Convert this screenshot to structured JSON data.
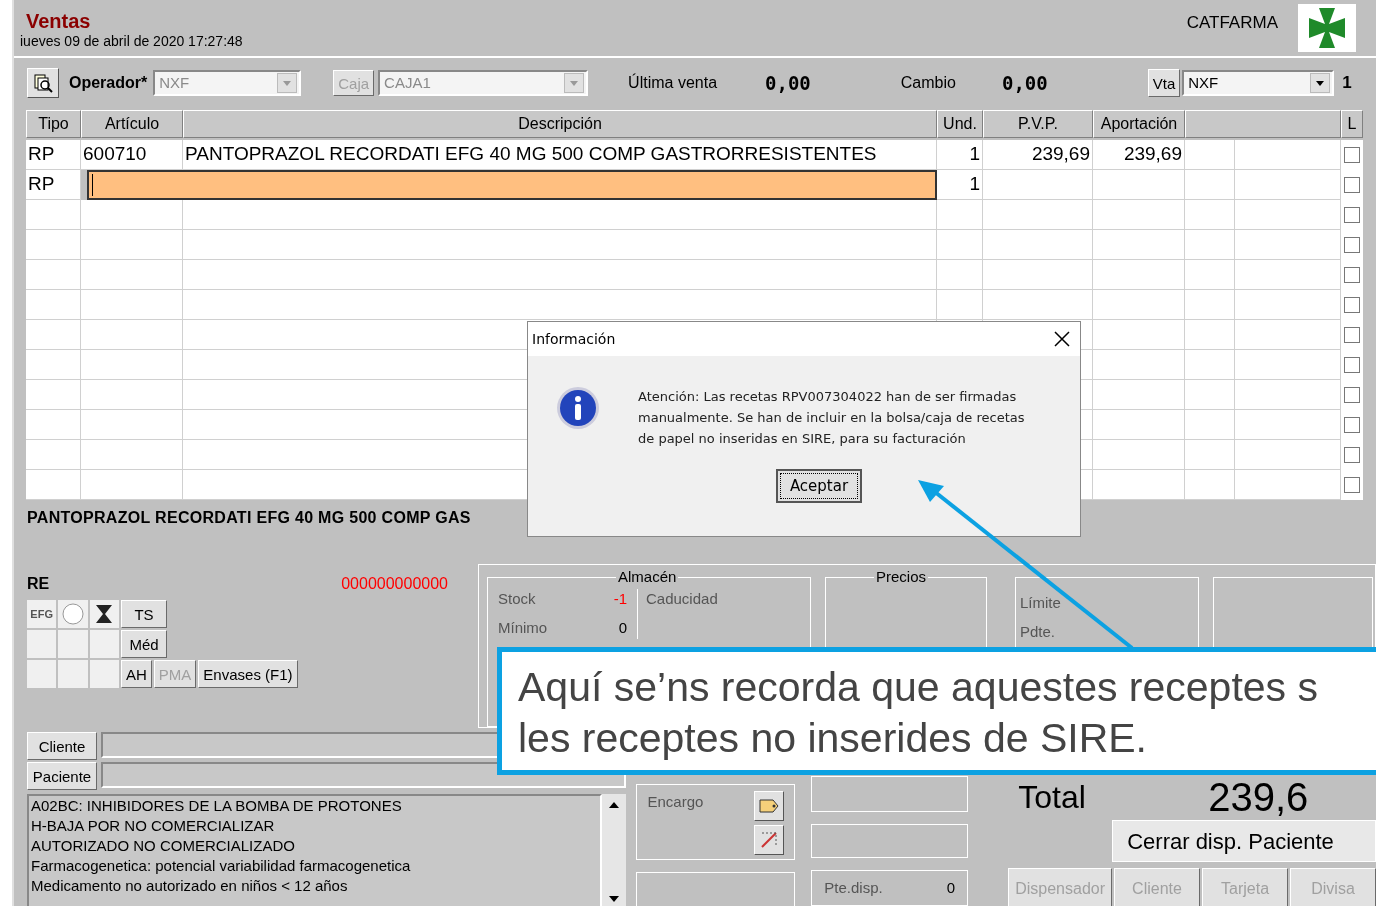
{
  "header": {
    "title": "Ventas",
    "datetime": "iueves 09 de abril de 2020 17:27:48",
    "brand": "CATFARMA"
  },
  "toolbar": {
    "operator_label": "Operador*",
    "operator_value": "NXF",
    "operator_disabled": true,
    "caja_button": {
      "label": "Caja",
      "disabled": true
    },
    "caja_value": "CAJA1",
    "last_sale_label": "Última venta",
    "last_sale_value": "0,00",
    "change_label": "Cambio",
    "change_value": "0,00",
    "vta_button": {
      "label": "Vta",
      "disabled": false
    },
    "vta_value": "NXF",
    "counter": "1"
  },
  "table": {
    "columns": [
      {
        "label": "Tipo"
      },
      {
        "label": "Artículo"
      },
      {
        "label": "Descripción"
      },
      {
        "label": "Und."
      },
      {
        "label": "P.V.P."
      },
      {
        "label": "Aportación"
      },
      {
        "kind": "blank"
      },
      {
        "label": "L"
      }
    ],
    "rows": [
      {
        "tipo": "RP",
        "articulo": "600710",
        "descripcion": "PANTOPRAZOL RECORDATI EFG 40 MG 500 COMP GASTRORRESISTENTES",
        "und": "1",
        "pvp": "239,69",
        "aportacion": "239,69",
        "editing": false,
        "checked": false
      },
      {
        "tipo": "RP",
        "und": "1",
        "editing": true,
        "checked": false
      }
    ],
    "blank_rows": [
      {
        "checked": false
      },
      {
        "checked": false
      },
      {
        "checked": false
      },
      {
        "checked": false
      },
      {
        "checked": false
      },
      {
        "checked": false
      },
      {
        "checked": false
      },
      {
        "checked": false
      },
      {
        "checked": false
      },
      {
        "checked": false
      }
    ]
  },
  "selected_description": "PANTOPRAZOL RECORDATI EFG 40 MG 500 COMP GAS",
  "re_panel": {
    "label": "RE",
    "code": "000000000000",
    "badge": "EFG",
    "buttons": [
      {
        "label": "TS",
        "disabled": false
      },
      {
        "label": "Méd",
        "disabled": false
      },
      {
        "label": "AH",
        "disabled": false
      },
      {
        "label": "PMA",
        "disabled": true
      },
      {
        "label": "Envases (F1)",
        "disabled": false
      }
    ]
  },
  "client_rows": [
    {
      "label": "Cliente"
    },
    {
      "label": "Paciente"
    }
  ],
  "notes": [
    "A02BC: INHIBIDORES DE LA BOMBA DE PROTONES",
    "H-BAJA POR NO COMERCIALIZAR",
    "AUTORIZADO NO COMERCIALIZADO",
    "Farmacogenetica: potencial variabilidad farmacogenetica",
    "Medicamento no autorizado en niños < 12 años"
  ],
  "almacen": {
    "title": "Almacén",
    "rows": [
      {
        "label": "Stock",
        "value": "-1",
        "negative": true
      },
      {
        "label": "Mínimo",
        "value": "0",
        "negative": false
      }
    ],
    "caducidad": "Caducidad"
  },
  "precios": {
    "title": "Precios"
  },
  "limits": [
    "Límite",
    "Pdte."
  ],
  "encargo": "Encargo",
  "pending": {
    "label": "Pte.disp.",
    "value": "0"
  },
  "total": {
    "label": "Total",
    "value": "239,6"
  },
  "close_button": "Cerrar disp. Paciente",
  "bottom_buttons": [
    {
      "label": "Dispensador",
      "disabled": true
    },
    {
      "label": "Cliente",
      "disabled": true
    },
    {
      "label": "Tarjeta",
      "disabled": true
    },
    {
      "label": "Divisa",
      "disabled": true
    }
  ],
  "dialog": {
    "title": "Información",
    "message": "Atención: Las recetas RPV007304022 han de ser firmadas manualmente. Se han de incluir en la bolsa/caja de recetas de papel no inseridas en SIRE, para su facturación",
    "button": "Aceptar"
  },
  "callout": {
    "lines": [
      "Aquí se’ns recorda que aquestes receptes s",
      "les receptes no inserides de SIRE."
    ]
  }
}
